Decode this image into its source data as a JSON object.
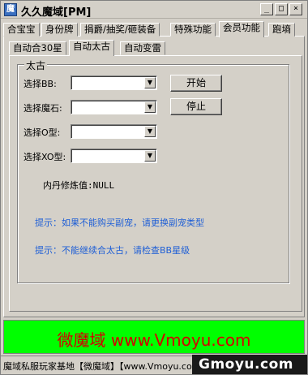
{
  "window": {
    "title": "久久魔域[PM]",
    "buttons": {
      "minimize": "_",
      "maximize": "□",
      "close": "×"
    }
  },
  "tabs": [
    {
      "label": "合宝宝"
    },
    {
      "label": "身份牌"
    },
    {
      "label": "捐爵/抽奖/砸装备"
    },
    {
      "label": "特殊功能"
    },
    {
      "label": "会员功能"
    },
    {
      "label": "跑墒"
    }
  ],
  "subtabs": [
    {
      "label": "自动合30星"
    },
    {
      "label": "自动太古"
    },
    {
      "label": "自动变雷"
    }
  ],
  "group": {
    "title": "太古",
    "fields": [
      {
        "label": "选择BB:",
        "value": ""
      },
      {
        "label": "选择魔石:",
        "value": ""
      },
      {
        "label": "选择O型:",
        "value": ""
      },
      {
        "label": "选择XO型:",
        "value": ""
      }
    ],
    "start_label": "开始",
    "stop_label": "停止",
    "neidan_label": "内丹修炼值:",
    "neidan_value": "NULL",
    "tip1": "提示：如果不能购买副宠，请更换副宠类型",
    "tip2": "提示：不能继续合太古，请检查BB星级"
  },
  "banner": {
    "text": "微魔域 www.Vmoyu.com",
    "bg_color": "#00ff00",
    "text_color": "#d40000"
  },
  "statusbar": {
    "text": "魔域私服玩家基地【微魔域】【www.Vmoyu.com】"
  },
  "watermark": {
    "text": "Gmoyu.com"
  }
}
